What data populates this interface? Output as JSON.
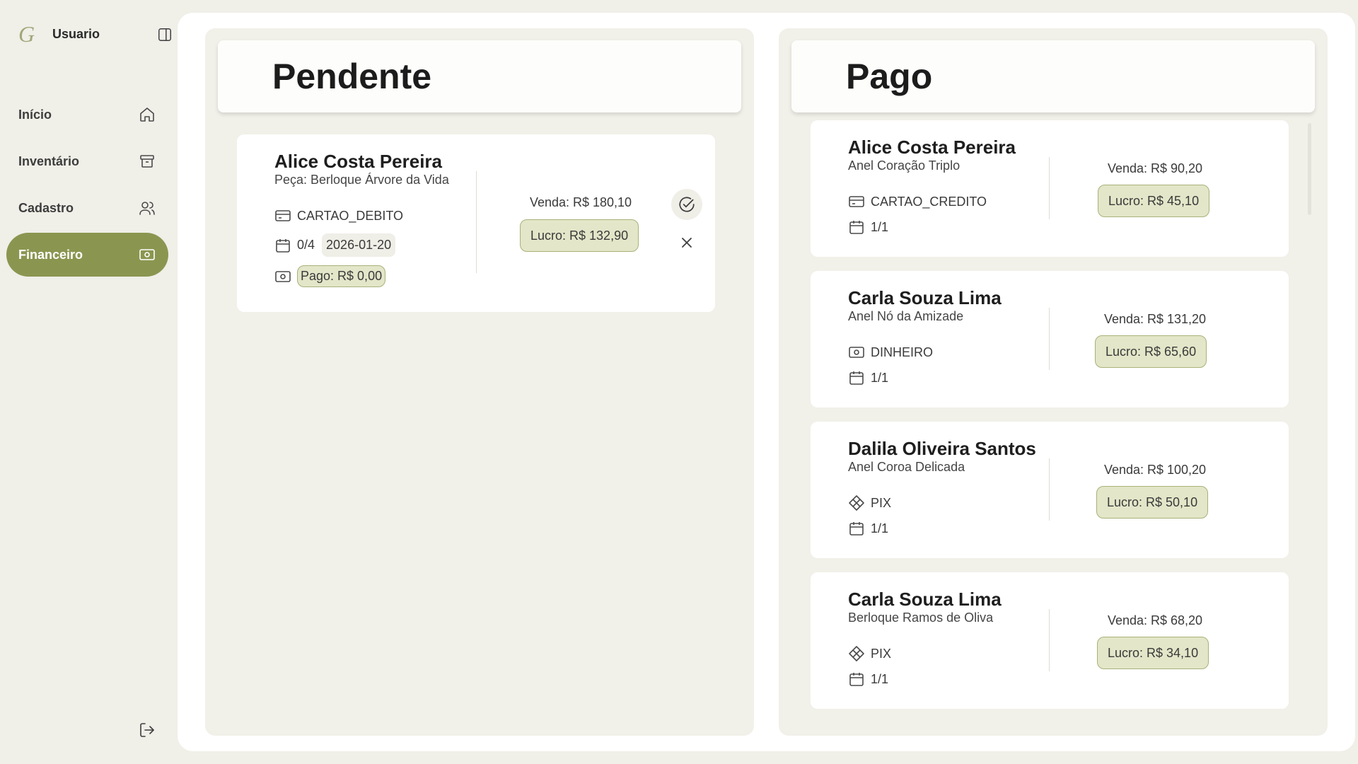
{
  "sidebar": {
    "logo": "G",
    "user": "Usuario",
    "items": [
      {
        "label": "Início",
        "icon": "home-icon"
      },
      {
        "label": "Inventário",
        "icon": "archive-icon"
      },
      {
        "label": "Cadastro",
        "icon": "users-icon"
      },
      {
        "label": "Financeiro",
        "icon": "banknote-icon"
      }
    ]
  },
  "pending": {
    "title": "Pendente",
    "cards": [
      {
        "name": "Alice Costa Pereira",
        "item": "Peça: Berloque Árvore da Vida",
        "payment_method": "CARTAO_DEBITO",
        "installments": "0/4",
        "due_date": "2026-01-20",
        "paid": "Pago: R$ 0,00",
        "sale": "Venda: R$ 180,10",
        "profit": "Lucro: R$ 132,90"
      }
    ]
  },
  "paid": {
    "title": "Pago",
    "cards": [
      {
        "name": "Alice Costa Pereira",
        "item": "Anel Coração Triplo",
        "payment_method": "CARTAO_CREDITO",
        "method_icon": "credit-card-icon",
        "installments": "1/1",
        "sale": "Venda: R$ 90,20",
        "profit": "Lucro: R$ 45,10"
      },
      {
        "name": "Carla Souza Lima",
        "item": "Anel Nó da Amizade",
        "payment_method": "DINHEIRO",
        "method_icon": "banknote-icon",
        "installments": "1/1",
        "sale": "Venda: R$ 131,20",
        "profit": "Lucro: R$ 65,60"
      },
      {
        "name": "Dalila Oliveira Santos",
        "item": "Anel Coroa Delicada",
        "payment_method": "PIX",
        "method_icon": "pix-icon",
        "installments": "1/1",
        "sale": "Venda: R$ 100,20",
        "profit": "Lucro: R$ 50,10"
      },
      {
        "name": "Carla Souza Lima",
        "item": "Berloque Ramos de Oliva",
        "payment_method": "PIX",
        "method_icon": "pix-icon",
        "installments": "1/1",
        "sale": "Venda: R$ 68,20",
        "profit": "Lucro: R$ 34,10"
      }
    ]
  },
  "colors": {
    "accent": "#8a9650",
    "pill_bg": "#e3e6c8",
    "pill_border": "#a8b27a",
    "page_bg": "#f0efe8"
  }
}
